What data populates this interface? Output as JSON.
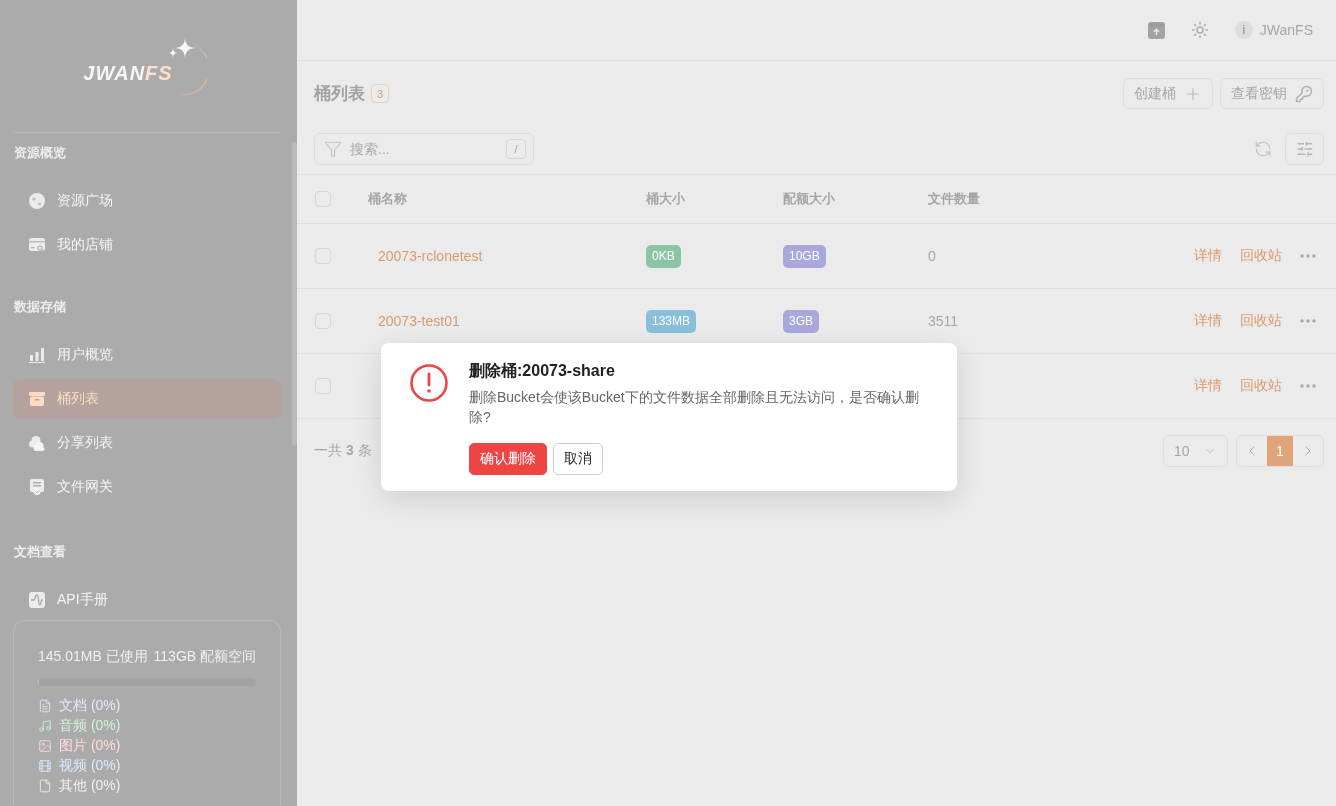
{
  "sidebar": {
    "logo": {
      "text": "JWAN",
      "accent": "FS"
    },
    "sections": [
      {
        "title": "资源概览",
        "items": [
          {
            "label": "资源广场",
            "kind": "globe",
            "selected": false
          },
          {
            "label": "我的店铺",
            "kind": "store",
            "selected": false
          }
        ]
      },
      {
        "title": "数据存储",
        "items": [
          {
            "label": "用户概览",
            "kind": "chart",
            "selected": false
          },
          {
            "label": "桶列表",
            "kind": "archive",
            "selected": true
          },
          {
            "label": "分享列表",
            "kind": "cloud",
            "selected": false
          },
          {
            "label": "文件网关",
            "kind": "gateway",
            "selected": false
          }
        ]
      },
      {
        "title": "文档查看",
        "items": [
          {
            "label": "API手册",
            "kind": "api",
            "selected": false
          }
        ]
      }
    ],
    "storage": {
      "used": "145.01MB 已使用",
      "quota": "113GB 配额空间",
      "level": 0.001,
      "categories": [
        {
          "label": "文档 (0%)",
          "kind": "document",
          "color": "#e6e6ff"
        },
        {
          "label": "音频 (0%)",
          "kind": "audio",
          "color": "#d0f4d6"
        },
        {
          "label": "图片 (0%)",
          "kind": "image",
          "color": "#ffdcdc"
        },
        {
          "label": "视频 (0%)",
          "kind": "video",
          "color": "#d8ecff"
        },
        {
          "label": "其他 (0%)",
          "kind": "other",
          "color": "#f0f0f0"
        }
      ]
    }
  },
  "header": {
    "avatar": "i",
    "user": "JWanFS"
  },
  "page": {
    "title": "桶列表",
    "count": "3",
    "actions": [
      {
        "label": "创建桶",
        "kind": "create"
      },
      {
        "label": "查看密钥",
        "kind": "key"
      }
    ]
  },
  "search": {
    "placeholder": "搜索...",
    "shortcut": "/"
  },
  "table": {
    "all_checked": false,
    "columns": [
      "桶名称",
      "桶大小",
      "配额大小",
      "文件数量"
    ],
    "rows": [
      {
        "checked": false,
        "name": "20073-rclonetest",
        "size": {
          "text": "0KB",
          "color": "#8cc4a4"
        },
        "quota": "10GB",
        "files": "0",
        "actions": [
          "详情",
          "回收站"
        ]
      },
      {
        "checked": false,
        "name": "20073-test01",
        "size": {
          "text": "133MB",
          "color": "#88c0dc"
        },
        "quota": "3GB",
        "files": "3511",
        "actions": [
          "详情",
          "回收站"
        ]
      },
      {
        "checked": false,
        "actions": [
          "详情",
          "回收站"
        ]
      }
    ]
  },
  "pagination": {
    "total": "一共 **3** 条",
    "page_size": "10",
    "pages": [
      {
        "label": "1",
        "selected": true
      }
    ]
  },
  "dialog": {
    "title": "删除桶:20073-share",
    "message": "删除Bucket会使该Bucket下的文件数据全部删除且无法访问，是否确认删除?",
    "buttons": [
      {
        "label": "确认删除",
        "kind": "danger"
      },
      {
        "label": "取消",
        "kind": "default"
      }
    ]
  }
}
